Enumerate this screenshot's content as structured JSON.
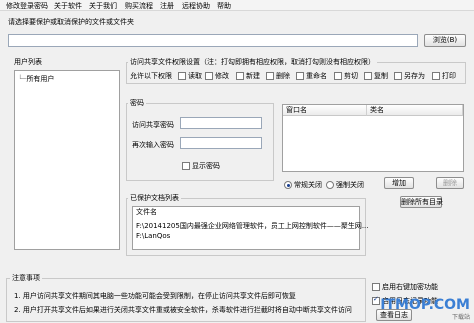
{
  "menu": [
    "修改登录密码",
    "关于软件",
    "关于我们",
    "购买流程",
    "注册",
    "远程协助",
    "帮助"
  ],
  "prompt": "请选择要保护或取消保护的文件或文件夹",
  "path_value": "",
  "browse_button": "浏览(B)",
  "user_list": {
    "label": "用户列表",
    "items": [
      "所有用户"
    ]
  },
  "permissions": {
    "label": "访问共享文件权限设置（注：打勾即拥有相应权限，取消打勾则没有相应权限）",
    "allow_label": "允许以下权限",
    "items": [
      {
        "label": "读取",
        "checked": false
      },
      {
        "label": "修改",
        "checked": false
      },
      {
        "label": "新建",
        "checked": false
      },
      {
        "label": "删除",
        "checked": false
      },
      {
        "label": "重命名",
        "checked": false
      },
      {
        "label": "剪切",
        "checked": false
      },
      {
        "label": "复制",
        "checked": false
      },
      {
        "label": "另存为",
        "checked": false
      },
      {
        "label": "打印",
        "checked": false
      }
    ]
  },
  "password": {
    "label": "密码",
    "access_label": "访问共享密码",
    "confirm_label": "再次输入密码",
    "access_value": "",
    "confirm_value": "",
    "show_label": "显示密码",
    "show_checked": false
  },
  "window_table": {
    "columns": [
      "窗口名",
      "类名"
    ],
    "rows": []
  },
  "close_mode": {
    "options": [
      {
        "label": "常规关闭",
        "checked": true
      },
      {
        "label": "强制关闭",
        "checked": false
      }
    ],
    "add_button": "增加",
    "delete_button": "删除"
  },
  "delete_dir_button": "删除所有目录",
  "protected_list": {
    "label": "已保护文档列表",
    "header": "文件名",
    "files": [
      "F:\\20141205国内最强企业网络管理软件，员工上网控制软件——聚生网...",
      "F:\\LanQos"
    ]
  },
  "notices": {
    "label": "注意事项",
    "items": [
      "1. 用户访问共享文件期间其电脑一些功能可能会受到限制，在停止访问共享文件后即可恢复",
      "2. 用户打开共享文件后如果进行关闭共享文件重或被安全软件，杀毒软件进行拦截时将自动中断共享文件访问"
    ]
  },
  "options": [
    {
      "label": "启用右键加密功能",
      "checked": false
    },
    {
      "label": "启用日志记录功能",
      "checked": true
    }
  ],
  "view_log_button": "查看日志",
  "watermark": {
    "main": "ITMOP.COM",
    "sub": "下载站"
  },
  "colors": {
    "background": "#f0f0f0",
    "accent": "#1a3f8f",
    "watermark": "#3b7fd4"
  }
}
